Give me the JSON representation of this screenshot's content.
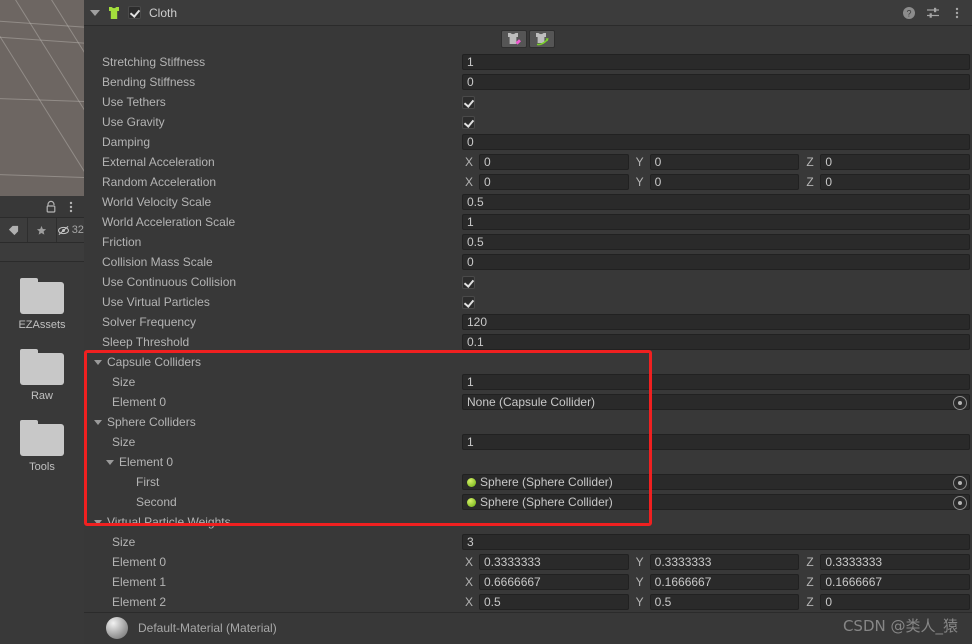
{
  "scene": {
    "name": "scene-view-grid"
  },
  "project_panel": {
    "toolbar": {
      "lock_icon": "lock-icon",
      "menu_icon": "kebab-menu-icon"
    },
    "filterbar": {
      "tag_icon": "tag-icon",
      "star_icon": "star-icon",
      "hidden_icon": "eye-off-icon",
      "count": "32"
    },
    "folders": [
      {
        "label": "EZAssets",
        "icon": "folder-icon"
      },
      {
        "label": "Raw",
        "icon": "folder-icon"
      },
      {
        "label": "Tools",
        "icon": "folder-icon"
      }
    ]
  },
  "inspector": {
    "header": {
      "component_icon": "cloth-icon",
      "enabled": true,
      "title": "Cloth",
      "help_icon": "help-icon",
      "preset_icon": "preset-settings-icon",
      "more_icon": "kebab-menu-icon"
    },
    "toolbar": {
      "buttons": [
        {
          "name": "cloth-paint-tool",
          "icon": "cloth-brush-icon"
        },
        {
          "name": "cloth-select-tool",
          "icon": "cloth-arrow-icon"
        }
      ]
    },
    "properties": [
      {
        "label": "Stretching Stiffness",
        "type": "number",
        "value": "1"
      },
      {
        "label": "Bending Stiffness",
        "type": "number",
        "value": "0"
      },
      {
        "label": "Use Tethers",
        "type": "bool",
        "value": true
      },
      {
        "label": "Use Gravity",
        "type": "bool",
        "value": true
      },
      {
        "label": "Damping",
        "type": "number",
        "value": "0"
      },
      {
        "label": "External Acceleration",
        "type": "vector3",
        "x": "0",
        "y": "0",
        "z": "0"
      },
      {
        "label": "Random Acceleration",
        "type": "vector3",
        "x": "0",
        "y": "0",
        "z": "0"
      },
      {
        "label": "World Velocity Scale",
        "type": "number",
        "value": "0.5"
      },
      {
        "label": "World Acceleration Scale",
        "type": "number",
        "value": "1"
      },
      {
        "label": "Friction",
        "type": "number",
        "value": "0.5"
      },
      {
        "label": "Collision Mass Scale",
        "type": "number",
        "value": "0"
      },
      {
        "label": "Use Continuous Collision",
        "type": "bool",
        "value": true
      },
      {
        "label": "Use Virtual Particles",
        "type": "bool",
        "value": true
      },
      {
        "label": "Solver Frequency",
        "type": "number",
        "value": "120"
      },
      {
        "label": "Sleep Threshold",
        "type": "number",
        "value": "0.1"
      }
    ],
    "capsule_colliders": {
      "label": "Capsule Colliders",
      "expanded": true,
      "size_label": "Size",
      "size_value": "1",
      "elements": [
        {
          "label": "Element 0",
          "value": "None (Capsule Collider)",
          "has_object": false
        }
      ]
    },
    "sphere_colliders": {
      "label": "Sphere Colliders",
      "expanded": true,
      "size_label": "Size",
      "size_value": "1",
      "element_label": "Element 0",
      "pairs": [
        {
          "label": "First",
          "value": "Sphere (Sphere Collider)",
          "has_object": true
        },
        {
          "label": "Second",
          "value": "Sphere (Sphere Collider)",
          "has_object": true
        }
      ]
    },
    "virtual_particle_weights": {
      "label": "Virtual Particle Weights",
      "expanded": true,
      "size_label": "Size",
      "size_value": "3",
      "elements": [
        {
          "label": "Element 0",
          "x": "0.3333333",
          "y": "0.3333333",
          "z": "0.3333333"
        },
        {
          "label": "Element 1",
          "x": "0.6666667",
          "y": "0.1666667",
          "z": "0.1666667"
        },
        {
          "label": "Element 2",
          "x": "0.5",
          "y": "0.5",
          "z": "0"
        }
      ]
    },
    "material_footer": {
      "icon": "material-sphere-icon",
      "label": "Default-Material (Material)"
    }
  },
  "annotation": {
    "highlight_color": "#f02020"
  },
  "watermark": {
    "text": "CSDN @类人_猿"
  },
  "axes": {
    "x": "X",
    "y": "Y",
    "z": "Z"
  }
}
